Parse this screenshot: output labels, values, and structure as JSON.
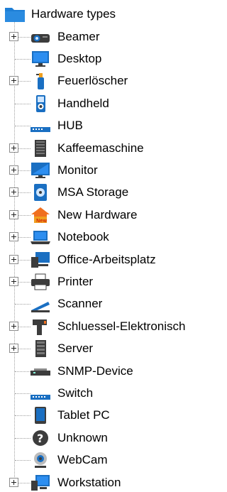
{
  "tree": {
    "root_label": "Hardware types",
    "items": [
      {
        "label": "Beamer",
        "expandable": true,
        "icon": "beamer-icon"
      },
      {
        "label": "Desktop",
        "expandable": false,
        "icon": "desktop-icon"
      },
      {
        "label": "Feuerlöscher",
        "expandable": true,
        "icon": "fire-extinguisher-icon"
      },
      {
        "label": "Handheld",
        "expandable": false,
        "icon": "handheld-icon"
      },
      {
        "label": "HUB",
        "expandable": false,
        "icon": "hub-icon"
      },
      {
        "label": "Kaffeemaschine",
        "expandable": true,
        "icon": "coffee-machine-icon"
      },
      {
        "label": "Monitor",
        "expandable": true,
        "icon": "monitor-icon"
      },
      {
        "label": "MSA Storage",
        "expandable": true,
        "icon": "storage-icon"
      },
      {
        "label": "New Hardware",
        "expandable": true,
        "icon": "new-hardware-icon"
      },
      {
        "label": "Notebook",
        "expandable": true,
        "icon": "notebook-icon"
      },
      {
        "label": "Office-Arbeitsplatz",
        "expandable": true,
        "icon": "office-workplace-icon"
      },
      {
        "label": "Printer",
        "expandable": true,
        "icon": "printer-icon"
      },
      {
        "label": "Scanner",
        "expandable": false,
        "icon": "scanner-icon"
      },
      {
        "label": "Schluessel-Elektronisch",
        "expandable": true,
        "icon": "electronic-key-icon"
      },
      {
        "label": "Server",
        "expandable": true,
        "icon": "server-icon"
      },
      {
        "label": "SNMP-Device",
        "expandable": false,
        "icon": "snmp-device-icon"
      },
      {
        "label": "Switch",
        "expandable": false,
        "icon": "switch-icon"
      },
      {
        "label": "Tablet PC",
        "expandable": false,
        "icon": "tablet-icon"
      },
      {
        "label": "Unknown",
        "expandable": false,
        "icon": "unknown-icon"
      },
      {
        "label": "WebCam",
        "expandable": false,
        "icon": "webcam-icon"
      },
      {
        "label": "Workstation",
        "expandable": true,
        "icon": "workstation-icon"
      }
    ]
  },
  "colors": {
    "folder": "#1e7fd6",
    "accent_blue": "#1a6fc2",
    "dark_gray": "#3c3c3c"
  }
}
